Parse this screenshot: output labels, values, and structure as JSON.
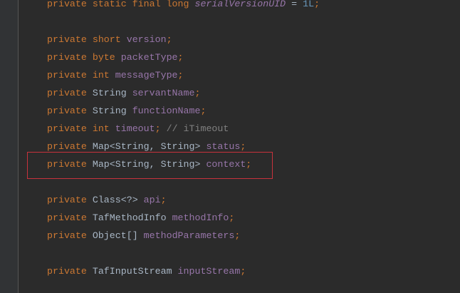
{
  "editor": {
    "language": "java",
    "highlight_color": "#c8323c",
    "lines": [
      [
        [
          "kw",
          "private static final long "
        ],
        [
          "sfield",
          "serialVersionUID"
        ],
        [
          "plain",
          " = "
        ],
        [
          "num",
          "1L"
        ],
        [
          "semi",
          ";"
        ]
      ],
      [],
      [
        [
          "kw",
          "private short "
        ],
        [
          "field",
          "version"
        ],
        [
          "semi",
          ";"
        ]
      ],
      [
        [
          "kw",
          "private byte "
        ],
        [
          "field",
          "packetType"
        ],
        [
          "semi",
          ";"
        ]
      ],
      [
        [
          "kw",
          "private int "
        ],
        [
          "field",
          "messageType"
        ],
        [
          "semi",
          ";"
        ]
      ],
      [
        [
          "kw",
          "private "
        ],
        [
          "type",
          "String "
        ],
        [
          "field",
          "servantName"
        ],
        [
          "semi",
          ";"
        ]
      ],
      [
        [
          "kw",
          "private "
        ],
        [
          "type",
          "String "
        ],
        [
          "field",
          "functionName"
        ],
        [
          "semi",
          ";"
        ]
      ],
      [
        [
          "kw",
          "private int "
        ],
        [
          "field",
          "timeout"
        ],
        [
          "semi",
          "; "
        ],
        [
          "cmt",
          "// iTimeout"
        ]
      ],
      [
        [
          "kw",
          "private "
        ],
        [
          "type",
          "Map<String, String> "
        ],
        [
          "field",
          "status"
        ],
        [
          "semi",
          ";"
        ]
      ],
      [
        [
          "kw",
          "private "
        ],
        [
          "type",
          "Map<String, String> "
        ],
        [
          "field",
          "context"
        ],
        [
          "semi",
          ";"
        ]
      ],
      [],
      [
        [
          "kw",
          "private "
        ],
        [
          "type",
          "Class<?> "
        ],
        [
          "field",
          "api"
        ],
        [
          "semi",
          ";"
        ]
      ],
      [
        [
          "kw",
          "private "
        ],
        [
          "type",
          "TafMethodInfo "
        ],
        [
          "field",
          "methodInfo"
        ],
        [
          "semi",
          ";"
        ]
      ],
      [
        [
          "kw",
          "private "
        ],
        [
          "type",
          "Object[] "
        ],
        [
          "field",
          "methodParameters"
        ],
        [
          "semi",
          ";"
        ]
      ],
      [],
      [
        [
          "kw",
          "private "
        ],
        [
          "type",
          "TafInputStream "
        ],
        [
          "field",
          "inputStream"
        ],
        [
          "semi",
          ";"
        ]
      ]
    ]
  }
}
